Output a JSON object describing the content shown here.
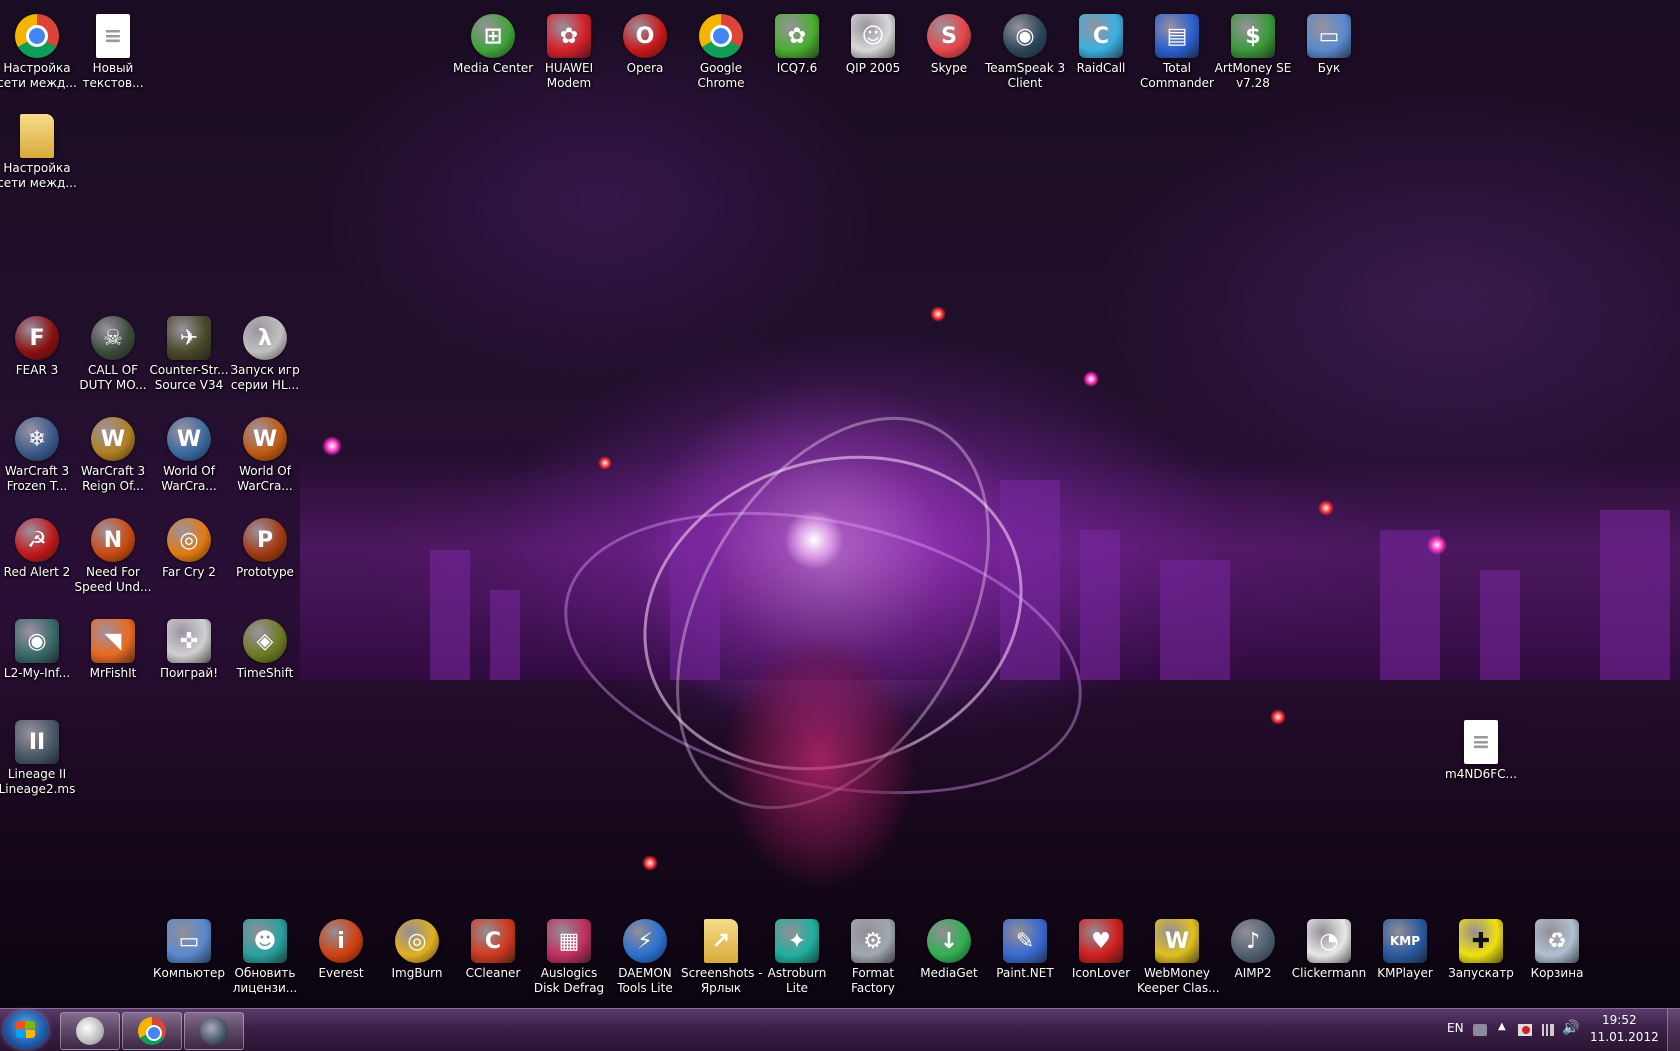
{
  "desktop": {
    "icons": [
      {
        "id": "net-settings",
        "label": "Настройка\nсети межд...",
        "icon": "chrome-icon",
        "color": "#e8e8e8"
      },
      {
        "id": "new-text",
        "label": "Новый\nтекстов...",
        "icon": "text-document-icon",
        "color": "#ffffff"
      },
      {
        "id": "net-settings-folder",
        "label": "Настройка\nсети межд...",
        "icon": "folder-icon",
        "color": "#e8c45a"
      },
      {
        "id": "media-center",
        "label": "Media Center",
        "icon": "windows-media-center-icon",
        "color": "#3fa33a"
      },
      {
        "id": "huawei",
        "label": "HUAWEI\nModem",
        "icon": "huawei-icon",
        "color": "#d6202a"
      },
      {
        "id": "opera",
        "label": "Opera",
        "icon": "opera-icon",
        "color": "#c81818"
      },
      {
        "id": "google-chrome",
        "label": "Google\nChrome",
        "icon": "chrome-icon",
        "color": "#e8e8e8"
      },
      {
        "id": "icq",
        "label": "ICQ7.6",
        "icon": "icq-flower-icon",
        "color": "#4caf2f"
      },
      {
        "id": "qip",
        "label": "QIP 2005",
        "icon": "qip-cat-icon",
        "color": "#d8d8d8"
      },
      {
        "id": "skype",
        "label": "Skype",
        "icon": "skype-icon",
        "color": "#e8454a"
      },
      {
        "id": "teamspeak",
        "label": "TeamSpeak 3\nClient",
        "icon": "teamspeak-icon",
        "color": "#2a4658"
      },
      {
        "id": "raidcall",
        "label": "RaidCall",
        "icon": "raidcall-icon",
        "color": "#3ab0e0"
      },
      {
        "id": "total-commander",
        "label": "Total\nCommander",
        "icon": "floppy-disk-icon",
        "color": "#2b5fd0"
      },
      {
        "id": "artmoney",
        "label": "ArtMoney SE\nv7.28",
        "icon": "money-icon",
        "color": "#3a9a3a"
      },
      {
        "id": "buk",
        "label": "Бук",
        "icon": "computer-icon",
        "color": "#5a8ad0"
      },
      {
        "id": "fear3",
        "label": "FEAR 3",
        "icon": "fear-game-icon",
        "color": "#8a1010"
      },
      {
        "id": "cod",
        "label": "CALL OF\nDUTY MO...",
        "icon": "cod-game-icon",
        "color": "#3a4a3a"
      },
      {
        "id": "cs",
        "label": "Counter-Str...\nSource V34",
        "icon": "counter-strike-icon",
        "color": "#4a4a2a"
      },
      {
        "id": "hl",
        "label": "Запуск игр\nсерии HL...",
        "icon": "half-life-icon",
        "color": "#c0c0c0"
      },
      {
        "id": "wc3-frozen",
        "label": "WarCraft 3\nFrozen T...",
        "icon": "warcraft-frozen-icon",
        "color": "#3a5a8a"
      },
      {
        "id": "wc3-reign",
        "label": "WarCraft 3\nReign Of...",
        "icon": "warcraft-reign-icon",
        "color": "#b08020"
      },
      {
        "id": "wow1",
        "label": "World Of\nWarCra...",
        "icon": "wow-icon",
        "color": "#3a6aa0"
      },
      {
        "id": "wow2",
        "label": "World Of\nWarCra...",
        "icon": "wow-cataclysm-icon",
        "color": "#c05a10"
      },
      {
        "id": "ra2",
        "label": "Red Alert 2",
        "icon": "red-alert-icon",
        "color": "#c01818"
      },
      {
        "id": "nfs",
        "label": "Need For\nSpeed Und...",
        "icon": "nfs-icon",
        "color": "#c84a10"
      },
      {
        "id": "farcry",
        "label": "Far Cry 2",
        "icon": "farcry-icon",
        "color": "#e07a10"
      },
      {
        "id": "prototype",
        "label": "Prototype",
        "icon": "prototype-icon",
        "color": "#a03a10"
      },
      {
        "id": "l2",
        "label": "L2-My-Inf...",
        "icon": "l2-orb-icon",
        "color": "#3a6a6a"
      },
      {
        "id": "mrfishit",
        "label": "MrFishIt",
        "icon": "fish-icon",
        "color": "#e86a20"
      },
      {
        "id": "poigrai",
        "label": "Поиграй!",
        "icon": "gamepad-icon",
        "color": "#d0d0d0"
      },
      {
        "id": "timeshift",
        "label": "TimeShift",
        "icon": "timeshift-icon",
        "color": "#6a7a20"
      },
      {
        "id": "lineage2",
        "label": "Lineage II\nLineage2.ms",
        "icon": "lineage-icon",
        "color": "#4a5a6a"
      },
      {
        "id": "m4nd",
        "label": "m4ND6FC...",
        "icon": "text-document-icon",
        "color": "#ffffff"
      },
      {
        "id": "computer",
        "label": "Компьютер",
        "icon": "computer-icon",
        "color": "#5a8ad0"
      },
      {
        "id": "update-license",
        "label": "Обновить\nлицензи...",
        "icon": "license-icon",
        "color": "#2aa0a0"
      },
      {
        "id": "everest",
        "label": "Everest",
        "icon": "everest-info-icon",
        "color": "#d04010"
      },
      {
        "id": "imgburn",
        "label": "ImgBurn",
        "icon": "imgburn-icon",
        "color": "#e0b020"
      },
      {
        "id": "ccleaner",
        "label": "CCleaner",
        "icon": "ccleaner-icon",
        "color": "#d03a20"
      },
      {
        "id": "auslogics",
        "label": "Auslogics\nDisk Defrag",
        "icon": "defrag-icon",
        "color": "#c03060"
      },
      {
        "id": "daemon",
        "label": "DAEMON\nTools Lite",
        "icon": "daemon-lightning-icon",
        "color": "#2a70d0"
      },
      {
        "id": "screenshots",
        "label": "Screenshots -\nЯрлык",
        "icon": "folder-shortcut-icon",
        "color": "#e8c45a"
      },
      {
        "id": "astroburn",
        "label": "Astroburn\nLite",
        "icon": "astroburn-icon",
        "color": "#20b0a0"
      },
      {
        "id": "format-factory",
        "label": "Format\nFactory",
        "icon": "format-factory-icon",
        "color": "#a0a8b0"
      },
      {
        "id": "mediaget",
        "label": "MediaGet",
        "icon": "mediaget-download-icon",
        "color": "#30b050"
      },
      {
        "id": "paintnet",
        "label": "Paint.NET",
        "icon": "paintnet-icon",
        "color": "#3a6ad0"
      },
      {
        "id": "iconlover",
        "label": "IconLover",
        "icon": "heart-icon",
        "color": "#d02020"
      },
      {
        "id": "webmoney",
        "label": "WebMoney\nKeeper Clas...",
        "icon": "webmoney-icon",
        "color": "#e0c020"
      },
      {
        "id": "aimp",
        "label": "AIMP2",
        "icon": "aimp-icon",
        "color": "#506070"
      },
      {
        "id": "clickermann",
        "label": "Clickermann",
        "icon": "mouse-icon",
        "color": "#e8e8e8"
      },
      {
        "id": "kmplayer",
        "label": "KMPlayer",
        "icon": "kmplayer-icon",
        "color": "#2a5aa0"
      },
      {
        "id": "zapuskatr",
        "label": "Запускатр",
        "icon": "plus-icon",
        "color": "#f0e010"
      },
      {
        "id": "recycle",
        "label": "Корзина",
        "icon": "recycle-bin-icon",
        "color": "#b0c0d0"
      }
    ]
  },
  "taskbar": {
    "start_label": "Start",
    "pinned": [
      {
        "id": "qip",
        "icon": "qip-cat-icon",
        "color": "#d8d8d8"
      },
      {
        "id": "chrome",
        "icon": "chrome-icon",
        "color": "#e0e0e0"
      },
      {
        "id": "lineage",
        "icon": "lineage-icon",
        "color": "#4a5a6a"
      }
    ],
    "tray": {
      "language": "EN",
      "time": "19:52",
      "date": "11.01.2012"
    }
  }
}
